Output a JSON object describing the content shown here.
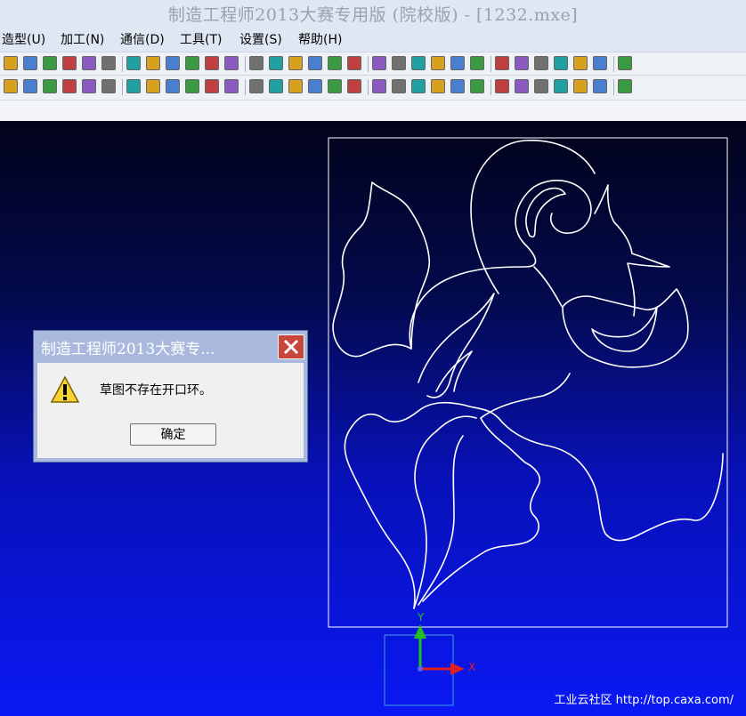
{
  "window": {
    "title": "制造工程师2013大赛专用版 (院校版) - [1232.mxe]"
  },
  "menu": {
    "items": [
      {
        "label": "造型(U)"
      },
      {
        "label": "加工(N)"
      },
      {
        "label": "通信(D)"
      },
      {
        "label": "工具(T)"
      },
      {
        "label": "设置(S)"
      },
      {
        "label": "帮助(H)"
      }
    ]
  },
  "toolbar": {
    "row1_icons": [
      "paste-icon",
      "undo-icon",
      "redo-icon",
      "light-icon",
      "sketch-icon",
      "filter-icon",
      "query-icon",
      "help-icon",
      "layer-icon",
      "pan-icon",
      "zoom-window-icon",
      "zoom-in-icon",
      "zoom-scale-icon",
      "rotate-icon",
      "move-icon",
      "wireframe-icon",
      "hidden-line-icon",
      "shaded-icon",
      "view-icon",
      "section-icon",
      "pick-icon",
      "surface-icon",
      "extrude-icon",
      "revolve-icon",
      "loft-icon",
      "shell-icon",
      "fillet-icon",
      "chamfer-icon",
      "rib-icon",
      "pattern-icon",
      "solid-icon"
    ],
    "row2_icons": [
      "cut-icon",
      "layer2-icon",
      "stack-icon",
      "sphere-icon",
      "curve-icon",
      "punch-icon",
      "roll-icon",
      "car-icon",
      "grid1-icon",
      "grid2-icon",
      "grid3-icon",
      "face-icon",
      "hole-icon",
      "wave-icon",
      "gear-icon",
      "axis-icon",
      "tool-icon",
      "drill1-icon",
      "drill2-icon",
      "drill3-icon",
      "path1-icon",
      "path2-icon",
      "path3-icon",
      "path4-icon",
      "path5-icon",
      "path6-icon",
      "path7-icon",
      "path8-icon",
      "path9-icon",
      "path10-icon",
      "path11-icon"
    ]
  },
  "viewport": {
    "axis_x_label": "X",
    "axis_y_label": "Y",
    "watermark": "工业云社区 http://top.caxa.com/"
  },
  "dialog": {
    "title": "制造工程师2013大赛专...",
    "message": "草图不存在开口环。",
    "ok_label": "确定",
    "icon": "warning-icon"
  },
  "colors": {
    "canvas_top": "#02031a",
    "canvas_bottom": "#0a18f3",
    "axis_x": "#e02020",
    "axis_y": "#20c020"
  }
}
